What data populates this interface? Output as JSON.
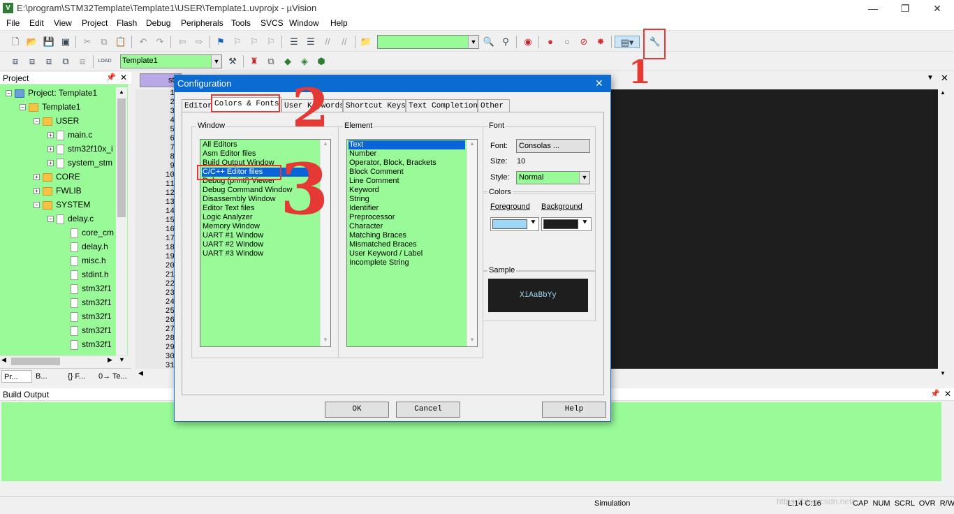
{
  "window": {
    "title": "E:\\program\\STM32Template\\Template1\\USER\\Template1.uvprojx - µVision",
    "minimize": "—",
    "maximize": "❐",
    "close": "✕"
  },
  "menu": [
    "File",
    "Edit",
    "View",
    "Project",
    "Flash",
    "Debug",
    "Peripherals",
    "Tools",
    "SVCS",
    "Window",
    "Help"
  ],
  "toolbar2": {
    "target_value": "Template1",
    "load_label": "LOAD"
  },
  "project_panel": {
    "title": "Project",
    "tree": [
      {
        "label": "Project: Template1",
        "kind": "proj",
        "level": 0,
        "exp": "−"
      },
      {
        "label": "Template1",
        "kind": "folder",
        "level": 1,
        "exp": "−"
      },
      {
        "label": "USER",
        "kind": "folder",
        "level": 2,
        "exp": "−"
      },
      {
        "label": "main.c",
        "kind": "doc",
        "level": 3,
        "exp": "+"
      },
      {
        "label": "stm32f10x_i",
        "kind": "doc",
        "level": 3,
        "exp": "+"
      },
      {
        "label": "system_stm",
        "kind": "doc",
        "level": 3,
        "exp": "+"
      },
      {
        "label": "CORE",
        "kind": "folder",
        "level": 2,
        "exp": "+"
      },
      {
        "label": "FWLIB",
        "kind": "folder",
        "level": 2,
        "exp": "+"
      },
      {
        "label": "SYSTEM",
        "kind": "folder",
        "level": 2,
        "exp": "−"
      },
      {
        "label": "delay.c",
        "kind": "doc",
        "level": 3,
        "exp": "−"
      },
      {
        "label": "core_cm",
        "kind": "doc",
        "level": 4,
        "exp": ""
      },
      {
        "label": "delay.h",
        "kind": "doc",
        "level": 4,
        "exp": ""
      },
      {
        "label": "misc.h",
        "kind": "doc",
        "level": 4,
        "exp": ""
      },
      {
        "label": "stdint.h",
        "kind": "doc",
        "level": 4,
        "exp": ""
      },
      {
        "label": "stm32f1",
        "kind": "doc",
        "level": 4,
        "exp": ""
      },
      {
        "label": "stm32f1",
        "kind": "doc",
        "level": 4,
        "exp": ""
      },
      {
        "label": "stm32f1",
        "kind": "doc",
        "level": 4,
        "exp": ""
      },
      {
        "label": "stm32f1",
        "kind": "doc",
        "level": 4,
        "exp": ""
      },
      {
        "label": "stm32f1",
        "kind": "doc",
        "level": 4,
        "exp": ""
      }
    ],
    "tabs": [
      "Pr...",
      "B...",
      "{} F...",
      "0→ Te..."
    ]
  },
  "editor": {
    "tab_label": "st",
    "line_numbers": [
      "1",
      "2",
      "3",
      "4",
      "5",
      "6",
      "7",
      "8",
      "9",
      "10",
      "11",
      "12",
      "13",
      "14",
      "15",
      "16",
      "17",
      "18",
      "19",
      "20",
      "21",
      "22",
      "23",
      "24",
      "25",
      "26",
      "27",
      "28",
      "29",
      "30",
      "31"
    ]
  },
  "build_output": {
    "title": "Build Output"
  },
  "status": {
    "mode": "Simulation",
    "position": "L:14 C:16",
    "flags": "CAP  NUM  SCRL  OVR  R/W",
    "watermark": "https://blog.csdn.net/..."
  },
  "dialog": {
    "title": "Configuration",
    "close": "✕",
    "tabs": [
      "Editor",
      "Colors & Fonts",
      "User Keywords",
      "Shortcut Keys",
      "Text Completion",
      "Other"
    ],
    "window_group": "Window",
    "window_items": [
      "All Editors",
      "Asm Editor files",
      "Build Output Window",
      "C/C++ Editor files",
      "Debug (printf) Viewer",
      "Debug Command Window",
      "Disassembly Window",
      "Editor Text files",
      "Logic Analyzer",
      "Memory Window",
      "UART #1 Window",
      "UART #2 Window",
      "UART #3 Window"
    ],
    "window_selected": "C/C++ Editor files",
    "element_group": "Element",
    "element_items": [
      "Text",
      "Number",
      "Operator, Block, Brackets",
      "Block Comment",
      "Line Comment",
      "Keyword",
      "String",
      "Identifier",
      "Preprocessor",
      "Character",
      "Matching Braces",
      "Mismatched Braces",
      "User Keyword / Label",
      "Incomplete String"
    ],
    "element_selected": "Text",
    "font_group": "Font",
    "font_label": "Font:",
    "font_button": "Consolas ...",
    "size_label": "Size:",
    "size_value": "10",
    "style_label": "Style:",
    "style_value": "Normal",
    "colors_group": "Colors",
    "foreground_label": "Foreground",
    "background_label": "Background",
    "foreground_color": "#9fd7f9",
    "background_color": "#1e1e1e",
    "sample_group": "Sample",
    "sample_text": "XiAaBbYy",
    "ok": "OK",
    "cancel": "Cancel",
    "help": "Help"
  },
  "annotations": [
    "1",
    "2",
    "3"
  ],
  "colors": {
    "accent": "#0b6bd0",
    "list_bg": "#98fb98",
    "highlight": "#e53935"
  }
}
